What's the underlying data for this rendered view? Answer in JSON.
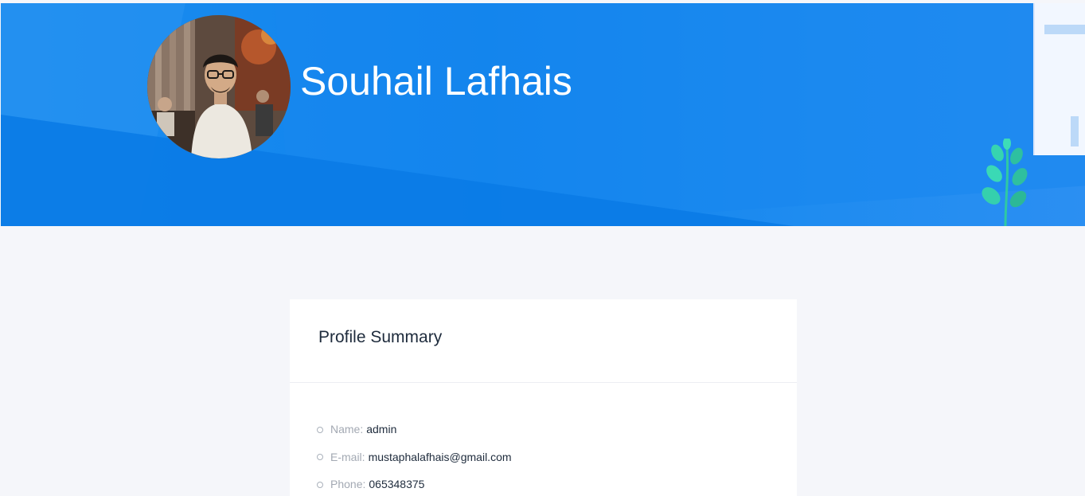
{
  "header": {
    "name": "Souhail Lafhais",
    "avatar_alt": "Profile photo"
  },
  "colors": {
    "banner": "#1585ee",
    "page_background": "#f5f6fa",
    "card_background": "#ffffff"
  },
  "profile_summary": {
    "title": "Profile Summary",
    "items": [
      {
        "label": "Name:",
        "value": "admin"
      },
      {
        "label": "E-mail:",
        "value": "mustaphalafhais@gmail.com"
      },
      {
        "label": "Phone:",
        "value": "065348375"
      }
    ]
  }
}
